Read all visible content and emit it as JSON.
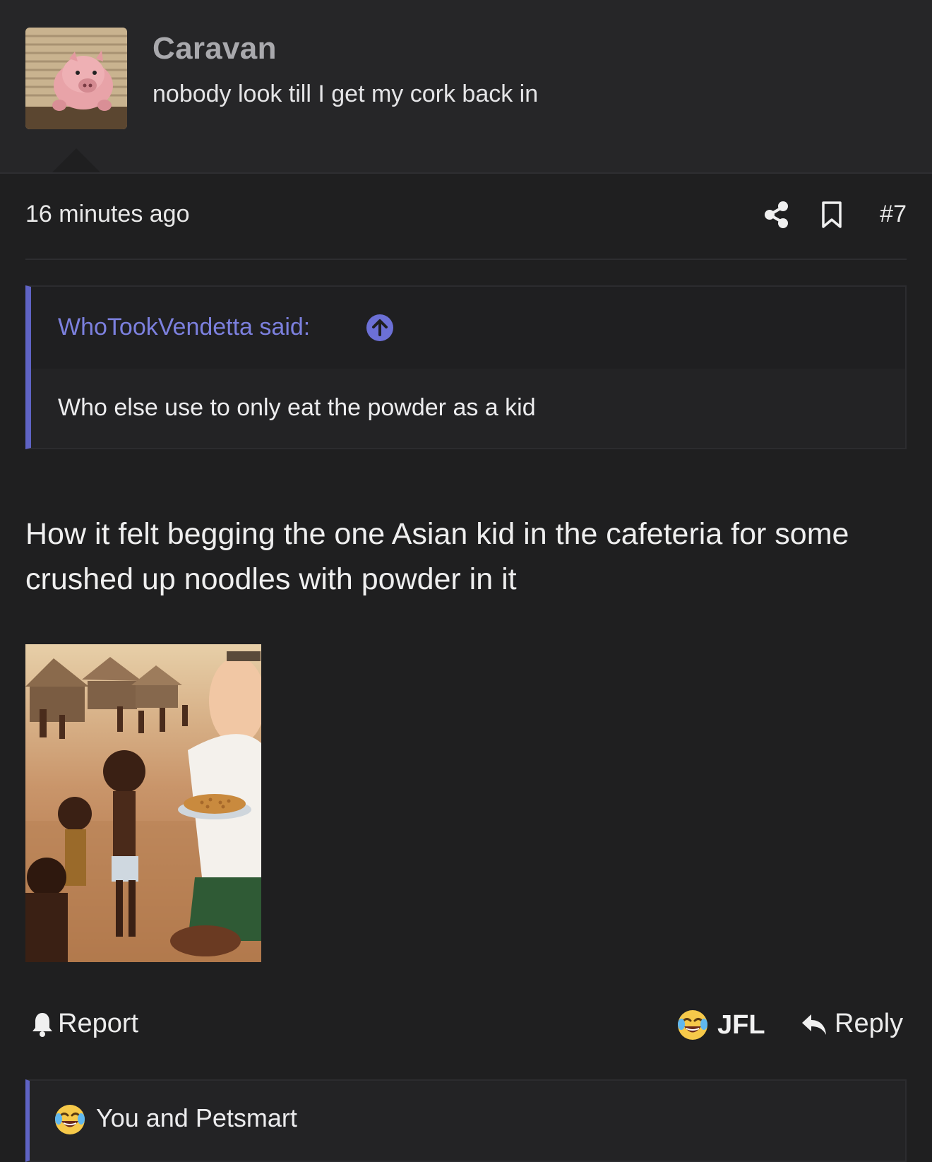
{
  "user": {
    "name": "Caravan",
    "title": "nobody look till I get my cork back in",
    "avatar_icon": "pink-pig-toy-avatar"
  },
  "post": {
    "time_ago": "16 minutes ago",
    "number": "#7",
    "icons": [
      "share-icon",
      "bookmark-icon"
    ],
    "body": "How it felt begging the one Asian kid in the cafeteria for some crushed up noodles with powder in it",
    "attachment_icon": "cartoon-food-bowl-image"
  },
  "quote": {
    "author": "WhoTookVendetta said:",
    "text": "Who else use to only eat the powder as a kid",
    "jump_icon": "arrow-up-circle-icon"
  },
  "actions": {
    "report": "Report",
    "reaction": "JFL",
    "reply": "Reply"
  },
  "reactions": {
    "summary": "You and Petsmart"
  },
  "colors": {
    "background": "#1f1f20",
    "header": "#262628",
    "accent": "#5f63c4",
    "quote_author": "#7c80de"
  }
}
